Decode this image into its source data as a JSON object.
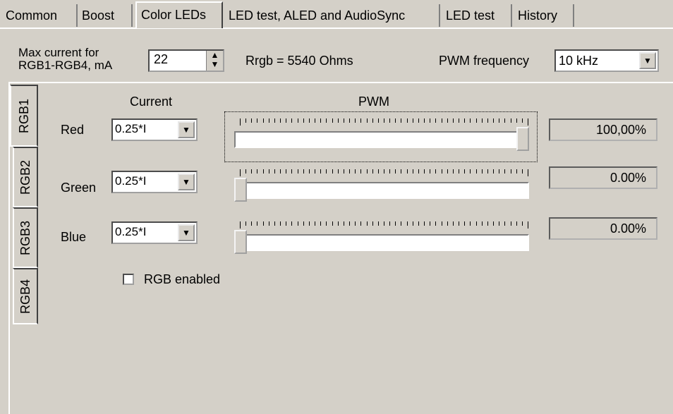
{
  "tabs": [
    {
      "label": "Common",
      "active": false
    },
    {
      "label": "Boost",
      "active": false
    },
    {
      "label": "Color LEDs",
      "active": true
    },
    {
      "label": "LED test, ALED and AudioSync",
      "active": false
    },
    {
      "label": "LED test",
      "active": false
    },
    {
      "label": "History",
      "active": false
    }
  ],
  "header": {
    "max_current_label_line1": "Max current for",
    "max_current_label_line2": "RGB1-RGB4, mA",
    "max_current_value": "22",
    "rrgb_text": "Rrgb = 5540 Ohms",
    "pwm_freq_label": "PWM frequency",
    "pwm_freq_value": "10 kHz"
  },
  "side_tabs": [
    {
      "label": "RGB1",
      "active": true
    },
    {
      "label": "RGB2",
      "active": false
    },
    {
      "label": "RGB3",
      "active": false
    },
    {
      "label": "RGB4",
      "active": false
    }
  ],
  "columns": {
    "current": "Current",
    "pwm": "PWM"
  },
  "rows": [
    {
      "label": "Red",
      "current": "0.25*I",
      "pwm_fraction": 1.0,
      "value_text": "100,00%",
      "focused": true
    },
    {
      "label": "Green",
      "current": "0.25*I",
      "pwm_fraction": 0.0,
      "value_text": "0.00%",
      "focused": false
    },
    {
      "label": "Blue",
      "current": "0.25*I",
      "pwm_fraction": 0.0,
      "value_text": "0.00%",
      "focused": false
    }
  ],
  "rgb_enabled": {
    "label": "RGB enabled",
    "checked": false
  },
  "icons": {
    "spin": "spin-updown-icon",
    "dropdown": "dropdown-arrow-icon"
  }
}
